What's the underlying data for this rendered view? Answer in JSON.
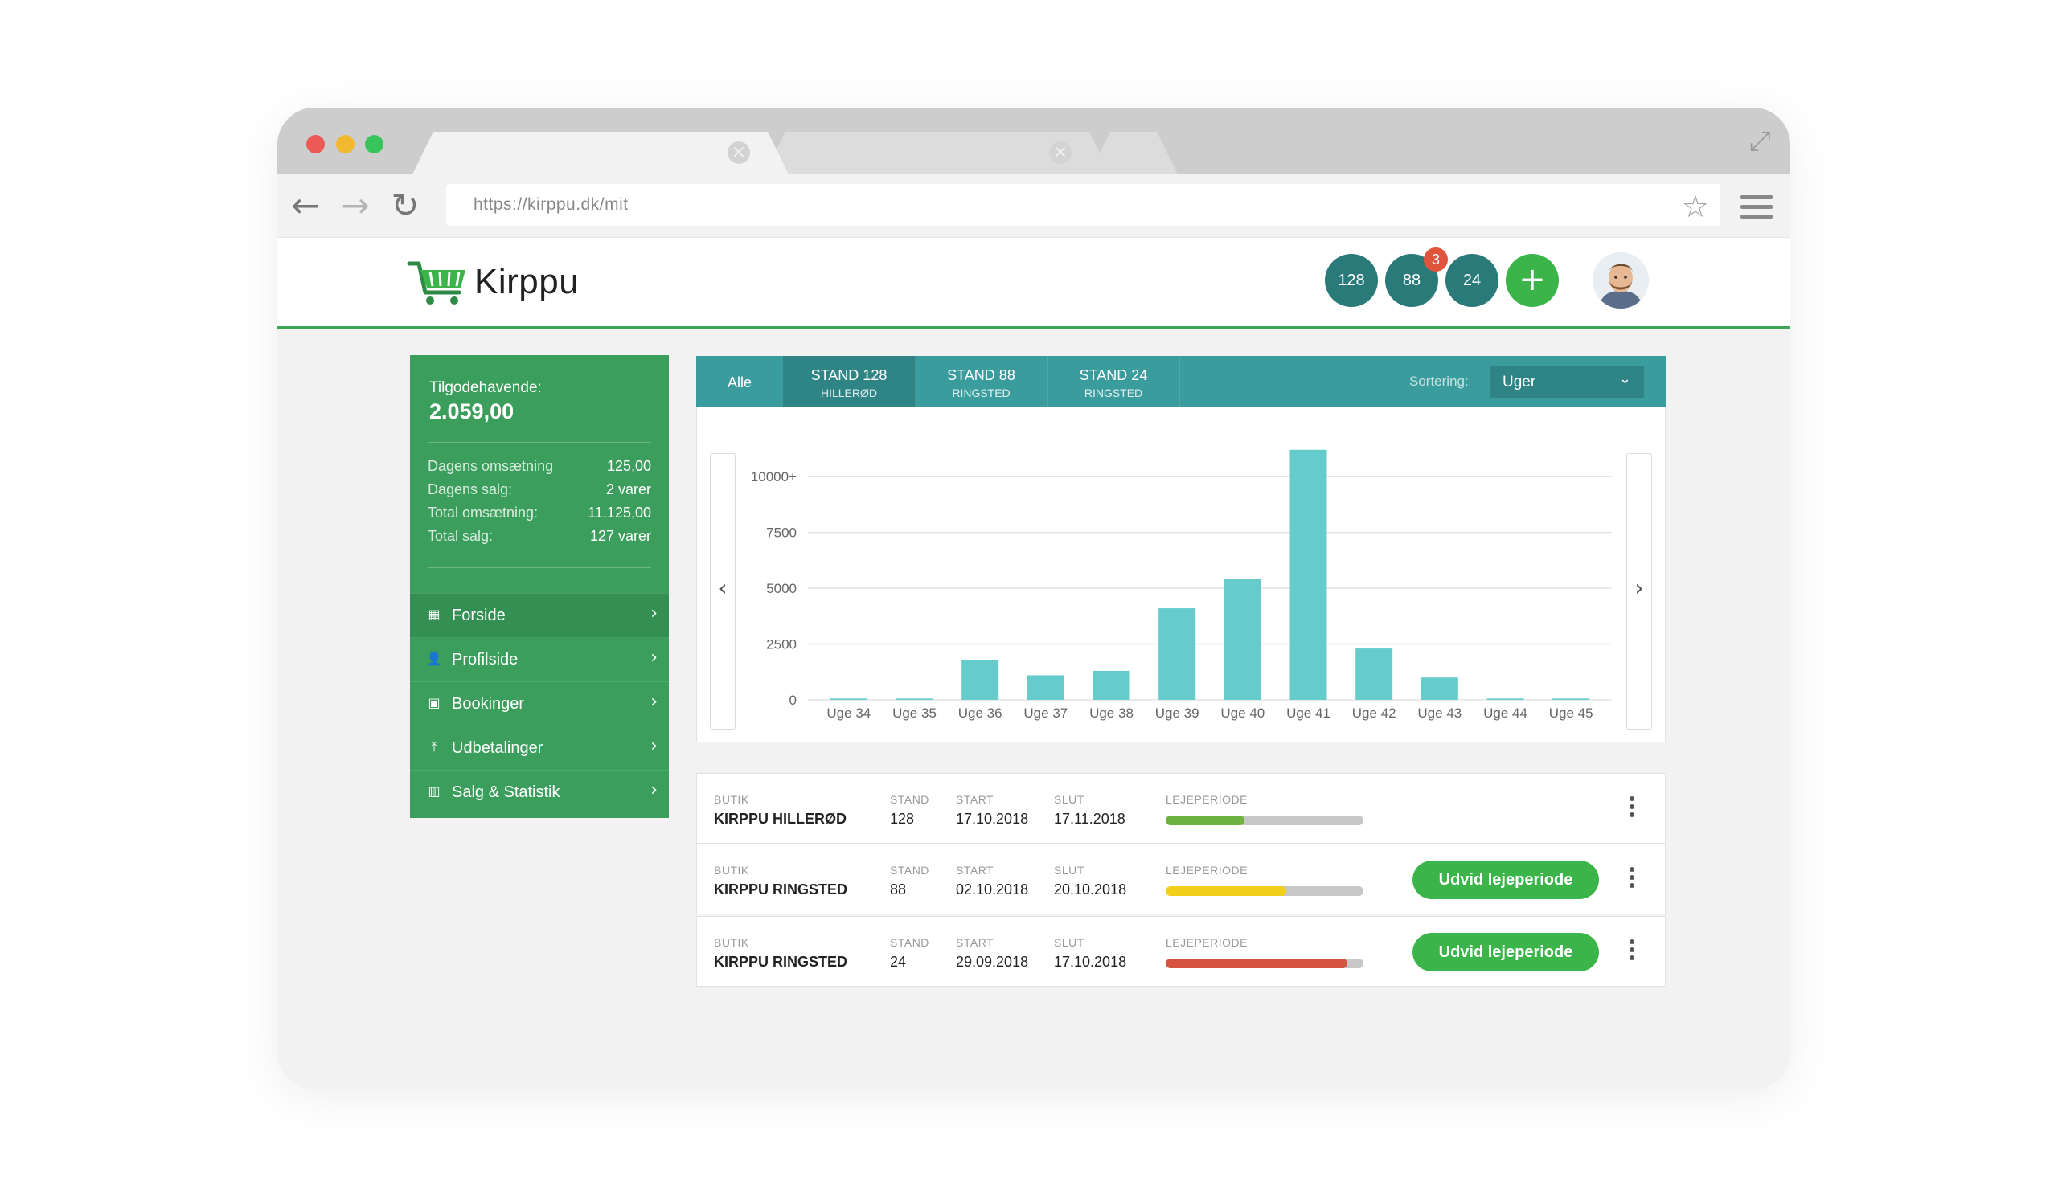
{
  "browser": {
    "url": "https://kirppu.dk/mit",
    "tab_close_glyph": "×",
    "nav": {
      "back": "←",
      "forward": "→",
      "reload": "↻",
      "star": "☆",
      "expand": "⤢"
    },
    "colors": {
      "red": "#ec5a55",
      "yellow": "#f2b830",
      "green": "#38c45a"
    }
  },
  "header": {
    "logo_text": "Kirppu",
    "badges": [
      {
        "label": "128"
      },
      {
        "label": "88",
        "notification": "3"
      },
      {
        "label": "24"
      }
    ],
    "add_label": "+"
  },
  "sidebar": {
    "balance_label": "Tilgodehavende:",
    "balance_value": "2.059,00",
    "stats": [
      {
        "label": "Dagens omsætning",
        "value": "125,00"
      },
      {
        "label": "Dagens salg:",
        "value": "2 varer"
      },
      {
        "label": "Total omsætning:",
        "value": "11.125,00"
      },
      {
        "label": "Total salg:",
        "value": "127 varer"
      }
    ],
    "items": [
      {
        "label": "Forside",
        "icon": "grid-icon",
        "glyph": "▦"
      },
      {
        "label": "Profilside",
        "icon": "user-icon",
        "glyph": "👤"
      },
      {
        "label": "Bookinger",
        "icon": "calendar-icon",
        "glyph": "▣"
      },
      {
        "label": "Udbetalinger",
        "icon": "upload-icon",
        "glyph": "⤒"
      },
      {
        "label": "Salg & Statistik",
        "icon": "bar-chart-icon",
        "glyph": "▥"
      }
    ],
    "chevron": "›"
  },
  "tabs": {
    "items": [
      {
        "line1": "Alle",
        "line2": ""
      },
      {
        "line1": "STAND 128",
        "line2": "HILLERØD"
      },
      {
        "line1": "STAND 88",
        "line2": "RINGSTED"
      },
      {
        "line1": "STAND 24",
        "line2": "RINGSTED"
      }
    ],
    "sort_label": "Sortering:",
    "sort_value": "Uger",
    "caret": "⌄"
  },
  "chart_nav": {
    "prev": "‹",
    "next": "›"
  },
  "chart_data": {
    "type": "bar",
    "categories": [
      "Uge 34",
      "Uge 35",
      "Uge 36",
      "Uge 37",
      "Uge 38",
      "Uge 39",
      "Uge 40",
      "Uge 41",
      "Uge 42",
      "Uge 43",
      "Uge 44",
      "Uge 45"
    ],
    "values": [
      60,
      60,
      1800,
      1100,
      1300,
      4100,
      5400,
      11200,
      2300,
      1000,
      60,
      60
    ],
    "ylim": [
      0,
      10000
    ],
    "yticks": [
      {
        "value": 0,
        "label": "0"
      },
      {
        "value": 2500,
        "label": "2500"
      },
      {
        "value": 5000,
        "label": "5000"
      },
      {
        "value": 7500,
        "label": "7500"
      },
      {
        "value": 10000,
        "label": "10000+"
      }
    ],
    "grid": true,
    "color": "#66cccb"
  },
  "table": {
    "col_labels": {
      "shop": "BUTIK",
      "stand": "STAND",
      "start": "START",
      "end": "SLUT",
      "period": "LEJEPERIODE"
    },
    "rows": [
      {
        "shop": "KIRPPU HILLERØD",
        "stand": "128",
        "start": "17.10.2018",
        "end": "17.11.2018",
        "progress": 0.4,
        "color": "#6db33f",
        "button": ""
      },
      {
        "shop": "KIRPPU RINGSTED",
        "stand": "88",
        "start": "02.10.2018",
        "end": "20.10.2018",
        "progress": 0.61,
        "color": "#f2cf1a",
        "button": "Udvid lejeperiode"
      },
      {
        "shop": "KIRPPU RINGSTED",
        "stand": "24",
        "start": "29.09.2018",
        "end": "17.10.2018",
        "progress": 0.92,
        "color": "#d6543f",
        "button": "Udvid lejeperiode"
      }
    ]
  }
}
